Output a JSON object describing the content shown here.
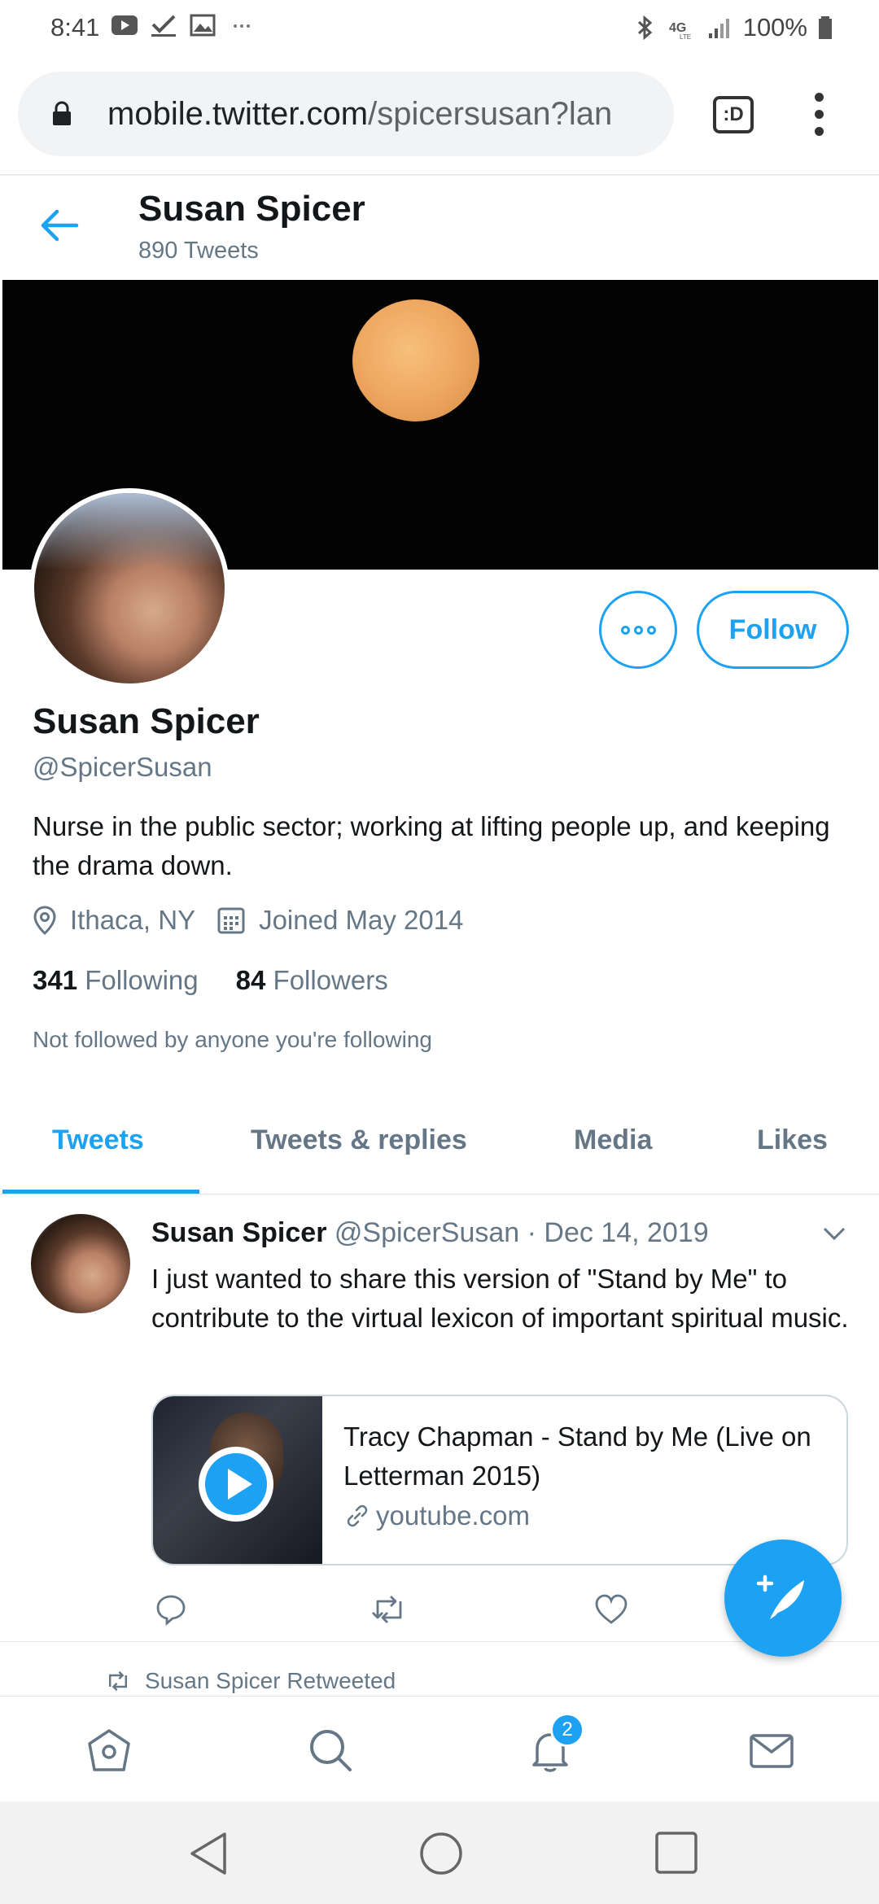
{
  "status_bar": {
    "time": "8:41",
    "battery": "100%"
  },
  "browser": {
    "url_domain": "mobile.twitter.com",
    "url_path": "/spicersusan?lan",
    "tab_icon_text": ":D"
  },
  "profile_header": {
    "name": "Susan Spicer",
    "tweet_count": "890 Tweets"
  },
  "profile": {
    "follow_label": "Follow",
    "name": "Susan Spicer",
    "handle": "@SpicerSusan",
    "bio": "Nurse in the public sector; working at lifting people up, and keeping the drama down.",
    "location": "Ithaca, NY",
    "joined": "Joined May 2014",
    "following_count": "341",
    "following_label": "Following",
    "followers_count": "84",
    "followers_label": "Followers",
    "follow_note": "Not followed by anyone you're following"
  },
  "tabs": [
    {
      "label": "Tweets",
      "active": true
    },
    {
      "label": "Tweets & replies",
      "active": false
    },
    {
      "label": "Media",
      "active": false
    },
    {
      "label": "Likes",
      "active": false
    }
  ],
  "tweet": {
    "author_name": "Susan Spicer",
    "author_handle": "@SpicerSusan",
    "separator": "·",
    "date": "Dec 14, 2019",
    "text": "I just wanted to share this version of \"Stand by Me\" to contribute to the virtual lexicon of important spiritual music.",
    "card_title": "Tracy Chapman - Stand by Me (Live on Letterman 2015)",
    "card_domain": "youtube.com"
  },
  "retweet_note": "Susan Spicer Retweeted",
  "notifications_badge": "2",
  "colors": {
    "accent": "#1da1f2",
    "secondary_text": "#657786",
    "primary_text": "#14171a"
  },
  "icons": [
    "back-arrow-icon",
    "lock-icon",
    "more-icon",
    "location-icon",
    "calendar-icon",
    "reply-icon",
    "retweet-icon",
    "like-icon",
    "home-icon",
    "search-icon",
    "bell-icon",
    "mail-icon",
    "compose-icon"
  ]
}
